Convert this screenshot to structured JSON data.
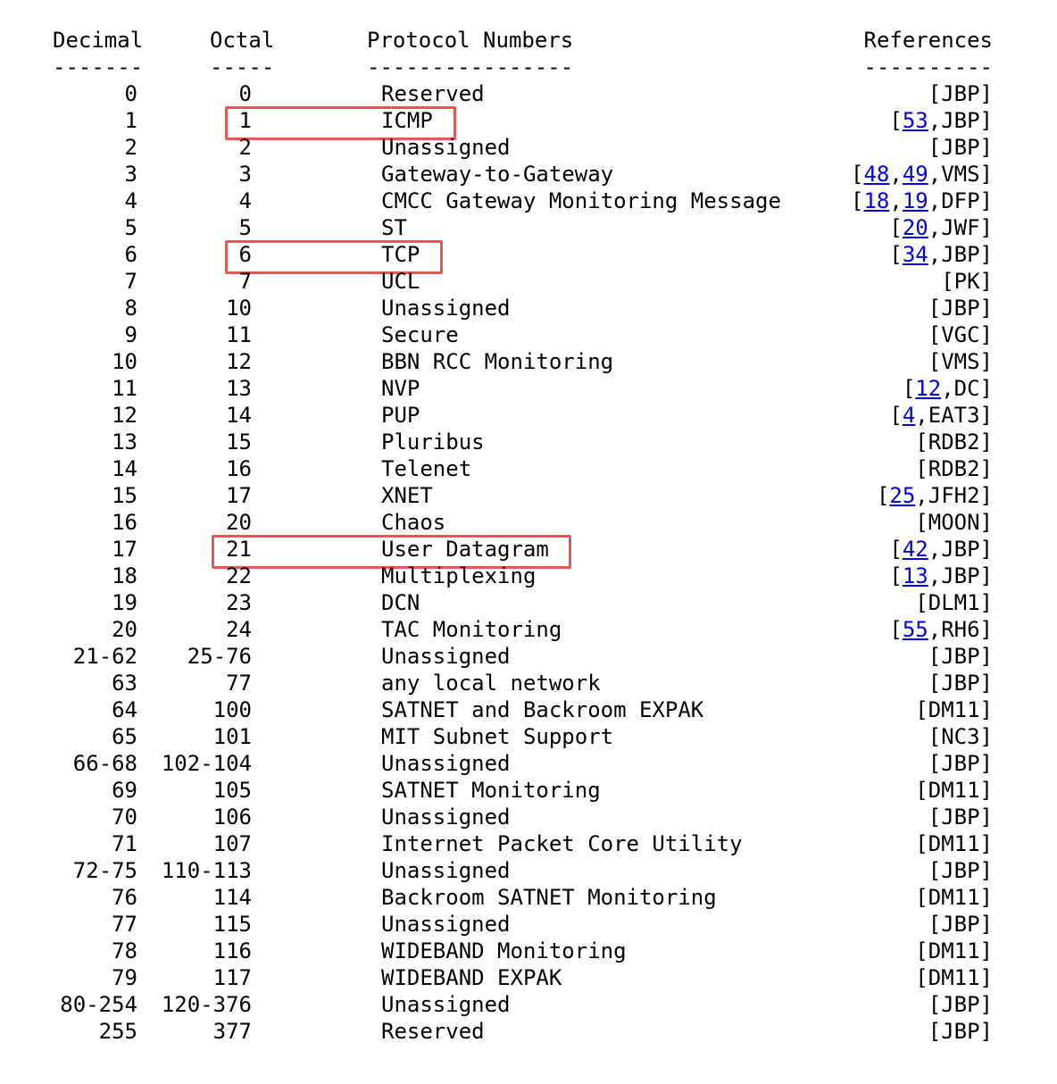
{
  "headers": {
    "decimal": "Decimal",
    "octal": "Octal",
    "protocol": "Protocol Numbers",
    "references": "References",
    "decimal_rule": "-------",
    "octal_rule": "-----",
    "protocol_rule": "----------------",
    "references_rule": "----------"
  },
  "rows": [
    {
      "dec": "0",
      "oct": "0",
      "prot": "Reserved",
      "ref": [
        {
          "t": "[JBP]"
        }
      ]
    },
    {
      "dec": "1",
      "oct": "1",
      "prot": "ICMP",
      "ref": [
        {
          "t": "["
        },
        {
          "t": "53",
          "link": true
        },
        {
          "t": ",JBP]"
        }
      ],
      "highlight": true
    },
    {
      "dec": "2",
      "oct": "2",
      "prot": "Unassigned",
      "ref": [
        {
          "t": "[JBP]"
        }
      ]
    },
    {
      "dec": "3",
      "oct": "3",
      "prot": "Gateway-to-Gateway",
      "ref": [
        {
          "t": "["
        },
        {
          "t": "48",
          "link": true
        },
        {
          "t": ","
        },
        {
          "t": "49",
          "link": true
        },
        {
          "t": ",VMS]"
        }
      ]
    },
    {
      "dec": "4",
      "oct": "4",
      "prot": "CMCC Gateway Monitoring Message",
      "ref": [
        {
          "t": "["
        },
        {
          "t": "18",
          "link": true
        },
        {
          "t": ","
        },
        {
          "t": "19",
          "link": true
        },
        {
          "t": ",DFP]"
        }
      ]
    },
    {
      "dec": "5",
      "oct": "5",
      "prot": "ST",
      "ref": [
        {
          "t": "["
        },
        {
          "t": "20",
          "link": true
        },
        {
          "t": ",JWF]"
        }
      ]
    },
    {
      "dec": "6",
      "oct": "6",
      "prot": "TCP",
      "ref": [
        {
          "t": "["
        },
        {
          "t": "34",
          "link": true
        },
        {
          "t": ",JBP]"
        }
      ],
      "highlight": true
    },
    {
      "dec": "7",
      "oct": "7",
      "prot": "UCL",
      "ref": [
        {
          "t": "[PK]"
        }
      ]
    },
    {
      "dec": "8",
      "oct": "10",
      "prot": "Unassigned",
      "ref": [
        {
          "t": "[JBP]"
        }
      ]
    },
    {
      "dec": "9",
      "oct": "11",
      "prot": "Secure",
      "ref": [
        {
          "t": "[VGC]"
        }
      ]
    },
    {
      "dec": "10",
      "oct": "12",
      "prot": "BBN RCC Monitoring",
      "ref": [
        {
          "t": "[VMS]"
        }
      ]
    },
    {
      "dec": "11",
      "oct": "13",
      "prot": "NVP",
      "ref": [
        {
          "t": "["
        },
        {
          "t": "12",
          "link": true
        },
        {
          "t": ",DC]"
        }
      ]
    },
    {
      "dec": "12",
      "oct": "14",
      "prot": "PUP",
      "ref": [
        {
          "t": "["
        },
        {
          "t": "4",
          "link": true
        },
        {
          "t": ",EAT3]"
        }
      ]
    },
    {
      "dec": "13",
      "oct": "15",
      "prot": "Pluribus",
      "ref": [
        {
          "t": "[RDB2]"
        }
      ]
    },
    {
      "dec": "14",
      "oct": "16",
      "prot": "Telenet",
      "ref": [
        {
          "t": "[RDB2]"
        }
      ]
    },
    {
      "dec": "15",
      "oct": "17",
      "prot": "XNET",
      "ref": [
        {
          "t": "["
        },
        {
          "t": "25",
          "link": true
        },
        {
          "t": ",JFH2]"
        }
      ]
    },
    {
      "dec": "16",
      "oct": "20",
      "prot": "Chaos",
      "ref": [
        {
          "t": "[MOON]"
        }
      ]
    },
    {
      "dec": "17",
      "oct": "21",
      "prot": "User Datagram",
      "ref": [
        {
          "t": "["
        },
        {
          "t": "42",
          "link": true
        },
        {
          "t": ",JBP]"
        }
      ],
      "highlight": true
    },
    {
      "dec": "18",
      "oct": "22",
      "prot": "Multiplexing",
      "ref": [
        {
          "t": "["
        },
        {
          "t": "13",
          "link": true
        },
        {
          "t": ",JBP]"
        }
      ]
    },
    {
      "dec": "19",
      "oct": "23",
      "prot": "DCN",
      "ref": [
        {
          "t": "[DLM1]"
        }
      ]
    },
    {
      "dec": "20",
      "oct": "24",
      "prot": "TAC Monitoring",
      "ref": [
        {
          "t": "["
        },
        {
          "t": "55",
          "link": true
        },
        {
          "t": ",RH6]"
        }
      ]
    },
    {
      "dec": "21-62",
      "oct": "25-76",
      "prot": "Unassigned",
      "ref": [
        {
          "t": "[JBP]"
        }
      ]
    },
    {
      "dec": "63",
      "oct": "77",
      "prot": "any local network",
      "ref": [
        {
          "t": "[JBP]"
        }
      ]
    },
    {
      "dec": "64",
      "oct": "100",
      "prot": "SATNET and Backroom EXPAK",
      "ref": [
        {
          "t": "[DM11]"
        }
      ]
    },
    {
      "dec": "65",
      "oct": "101",
      "prot": "MIT Subnet Support",
      "ref": [
        {
          "t": "[NC3]"
        }
      ]
    },
    {
      "dec": "66-68",
      "oct": "102-104",
      "prot": "Unassigned",
      "ref": [
        {
          "t": "[JBP]"
        }
      ]
    },
    {
      "dec": "69",
      "oct": "105",
      "prot": "SATNET Monitoring",
      "ref": [
        {
          "t": "[DM11]"
        }
      ]
    },
    {
      "dec": "70",
      "oct": "106",
      "prot": "Unassigned",
      "ref": [
        {
          "t": "[JBP]"
        }
      ]
    },
    {
      "dec": "71",
      "oct": "107",
      "prot": "Internet Packet Core Utility",
      "ref": [
        {
          "t": "[DM11]"
        }
      ]
    },
    {
      "dec": "72-75",
      "oct": "110-113",
      "prot": "Unassigned",
      "ref": [
        {
          "t": "[JBP]"
        }
      ]
    },
    {
      "dec": "76",
      "oct": "114",
      "prot": "Backroom SATNET Monitoring",
      "ref": [
        {
          "t": "[DM11]"
        }
      ]
    },
    {
      "dec": "77",
      "oct": "115",
      "prot": "Unassigned",
      "ref": [
        {
          "t": "[JBP]"
        }
      ]
    },
    {
      "dec": "78",
      "oct": "116",
      "prot": "WIDEBAND Monitoring",
      "ref": [
        {
          "t": "[DM11]"
        }
      ]
    },
    {
      "dec": "79",
      "oct": "117",
      "prot": "WIDEBAND EXPAK",
      "ref": [
        {
          "t": "[DM11]"
        }
      ]
    },
    {
      "dec": "80-254",
      "oct": "120-376",
      "prot": "Unassigned",
      "ref": [
        {
          "t": "[JBP]"
        }
      ]
    },
    {
      "dec": "255",
      "oct": "377",
      "prot": "Reserved",
      "ref": [
        {
          "t": "[JBP]"
        }
      ]
    }
  ],
  "highlight_color": "#e05a55",
  "link_color": "#0000ee"
}
